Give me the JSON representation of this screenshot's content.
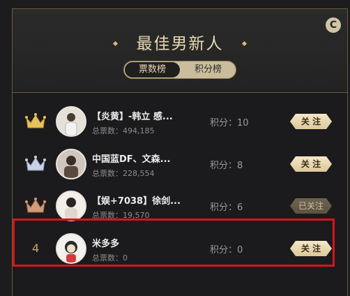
{
  "header": {
    "title": "最佳男新人",
    "refresh_icon": "C"
  },
  "tabs": [
    {
      "label": "票数榜",
      "active": true
    },
    {
      "label": "积分榜",
      "active": false
    }
  ],
  "rows": [
    {
      "rank": "1",
      "rank_type": "gold-crown-icon",
      "name": "【炎黄】-韩立 感...",
      "votes": "总票数：494,185",
      "score": "积分：10",
      "button": "关 注",
      "button_disabled": false
    },
    {
      "rank": "2",
      "rank_type": "silver-crown-icon",
      "name": "中国蓝DF、文森...",
      "votes": "总票数：228,554",
      "score": "积分：8",
      "button": "关 注",
      "button_disabled": false
    },
    {
      "rank": "3",
      "rank_type": "bronze-crown-icon",
      "name": "【娱+7038】徐剑...",
      "votes": "总票数：19,570",
      "score": "积分：6",
      "button": "已关注",
      "button_disabled": true
    },
    {
      "rank": "4",
      "rank_type": "number",
      "name": "米多多",
      "votes": "总票数：0",
      "score": "积分：0",
      "button": "关 注",
      "button_disabled": false
    }
  ],
  "colors": {
    "gold": "#e6c35a",
    "silver": "#c9d2e6",
    "bronze": "#d49a7a",
    "highlight": "#d9141a"
  }
}
